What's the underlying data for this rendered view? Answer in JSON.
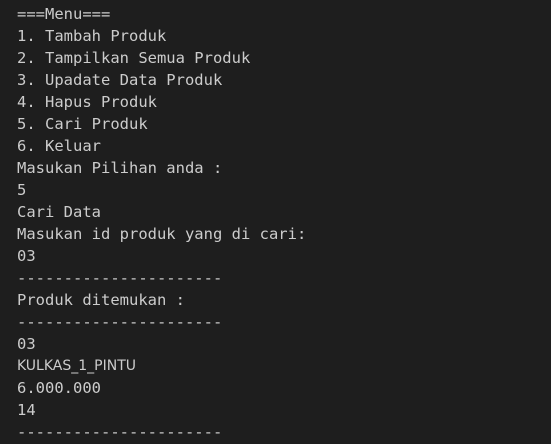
{
  "terminal": {
    "lines": [
      "===Menu===",
      "1. Tambah Produk",
      "2. Tampilkan Semua Produk",
      "3. Upadate Data Produk",
      "4. Hapus Produk",
      "5. Cari Produk",
      "6. Keluar",
      "Masukan Pilihan anda :",
      "5",
      "Cari Data",
      "Masukan id produk yang di cari:",
      "03",
      "----------------------",
      "Produk ditemukan :",
      "----------------------",
      "03",
      "KULKAS_1_PINTU",
      "6.000.000",
      "14",
      "----------------------"
    ]
  }
}
